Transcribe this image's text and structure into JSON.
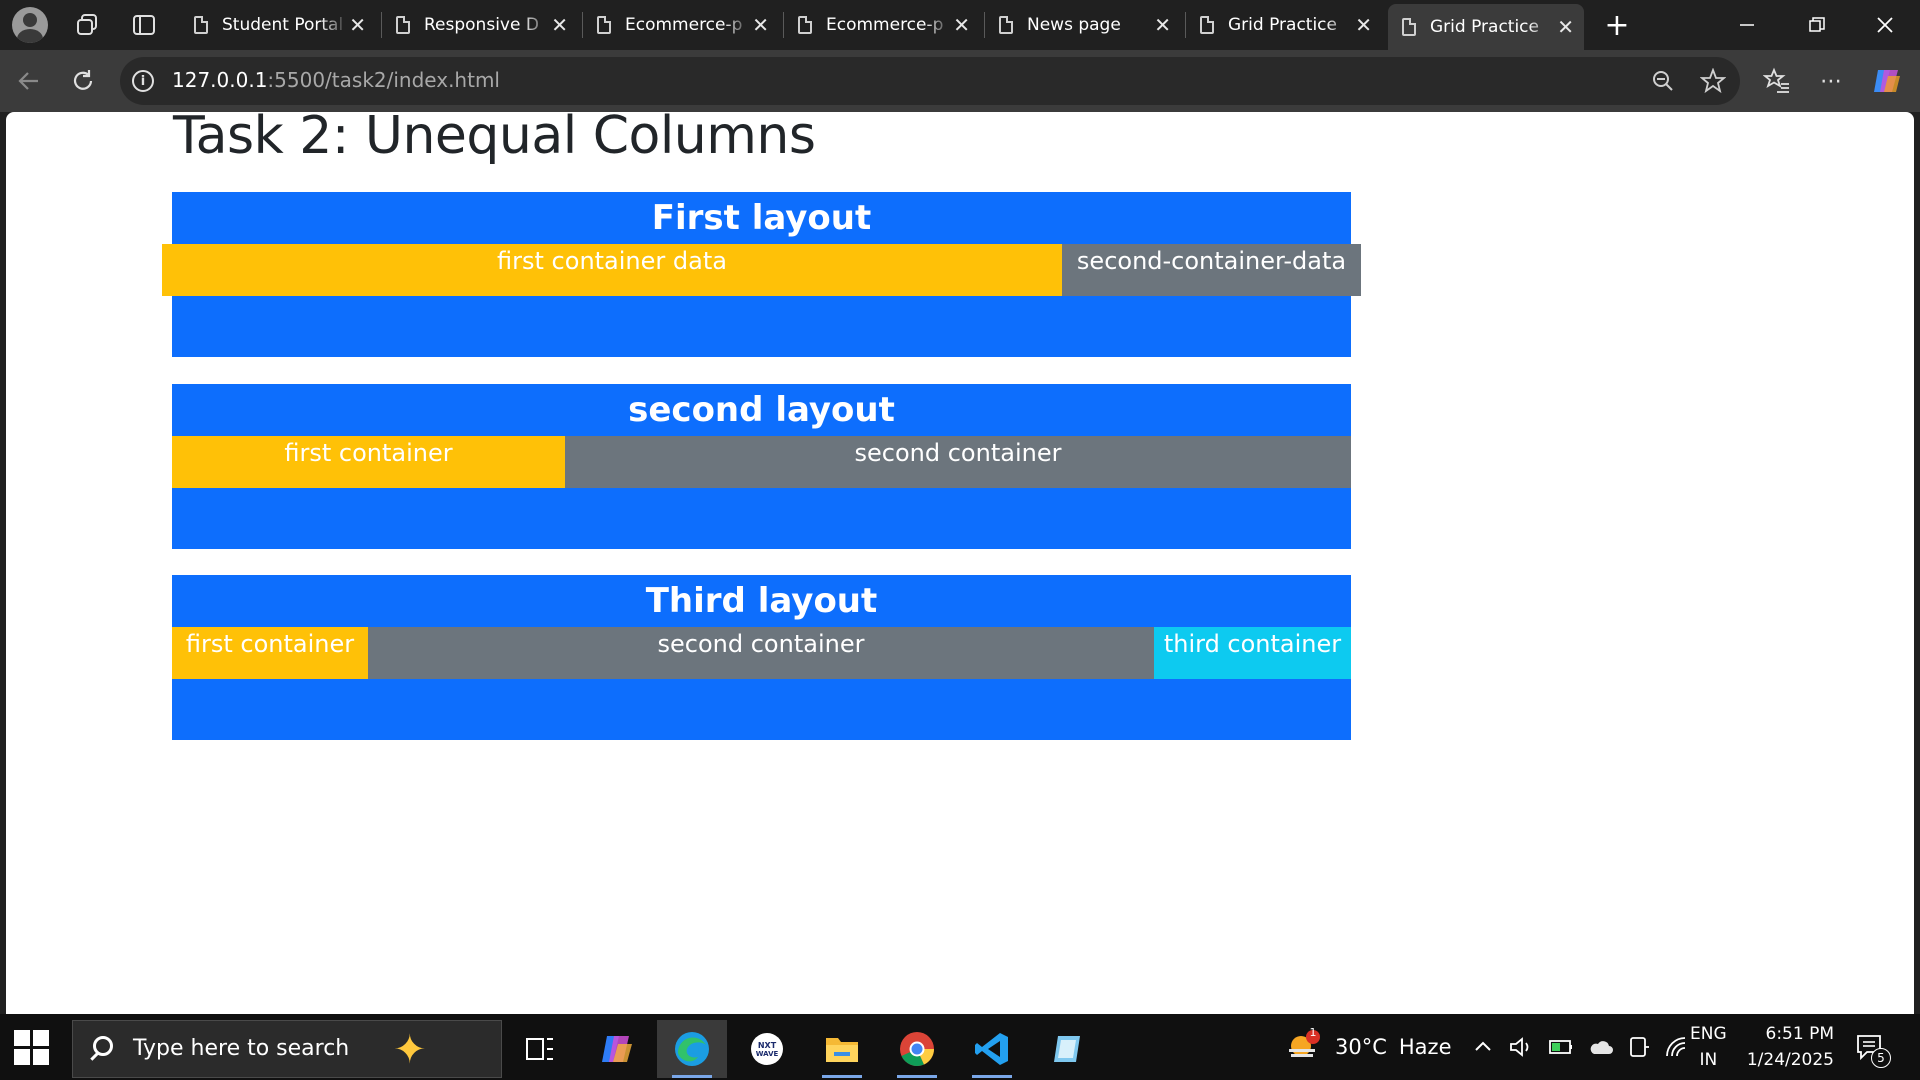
{
  "browser": {
    "tabs": [
      {
        "title": "Student Portal",
        "active": false
      },
      {
        "title": "Responsive D",
        "active": false
      },
      {
        "title": "Ecommerce-p",
        "active": false
      },
      {
        "title": "Ecommerce-p",
        "active": false
      },
      {
        "title": "News page",
        "active": false
      },
      {
        "title": "Grid Practice",
        "active": false
      },
      {
        "title": "Grid Practice",
        "active": true
      }
    ],
    "url_host": "127.0.0.1",
    "url_path": ":5500/task2/index.html"
  },
  "page": {
    "title": "Task 2: Unequal Columns",
    "layouts": [
      {
        "heading": "First layout",
        "cells": [
          "first container data",
          "second-container-data"
        ]
      },
      {
        "heading": "second layout",
        "cells": [
          "first container",
          "second container"
        ]
      },
      {
        "heading": "Third layout",
        "cells": [
          "first container",
          "second container",
          "third container"
        ]
      }
    ],
    "colors": {
      "primary": "#0d6efd",
      "warning": "#ffc107",
      "secondary": "#6c757d",
      "info": "#0dcaf0"
    }
  },
  "taskbar": {
    "search_placeholder": "Type here to search",
    "weather": {
      "temp": "30°C",
      "condition": "Haze",
      "badge": "1"
    },
    "language": {
      "lang": "ENG",
      "region": "IN"
    },
    "clock": {
      "time": "6:51 PM",
      "date": "1/24/2025"
    },
    "notification_count": "5",
    "apps": [
      "task-view",
      "copilot",
      "edge",
      "nxtwave",
      "file-explorer",
      "chrome",
      "vscode",
      "notepad"
    ]
  }
}
